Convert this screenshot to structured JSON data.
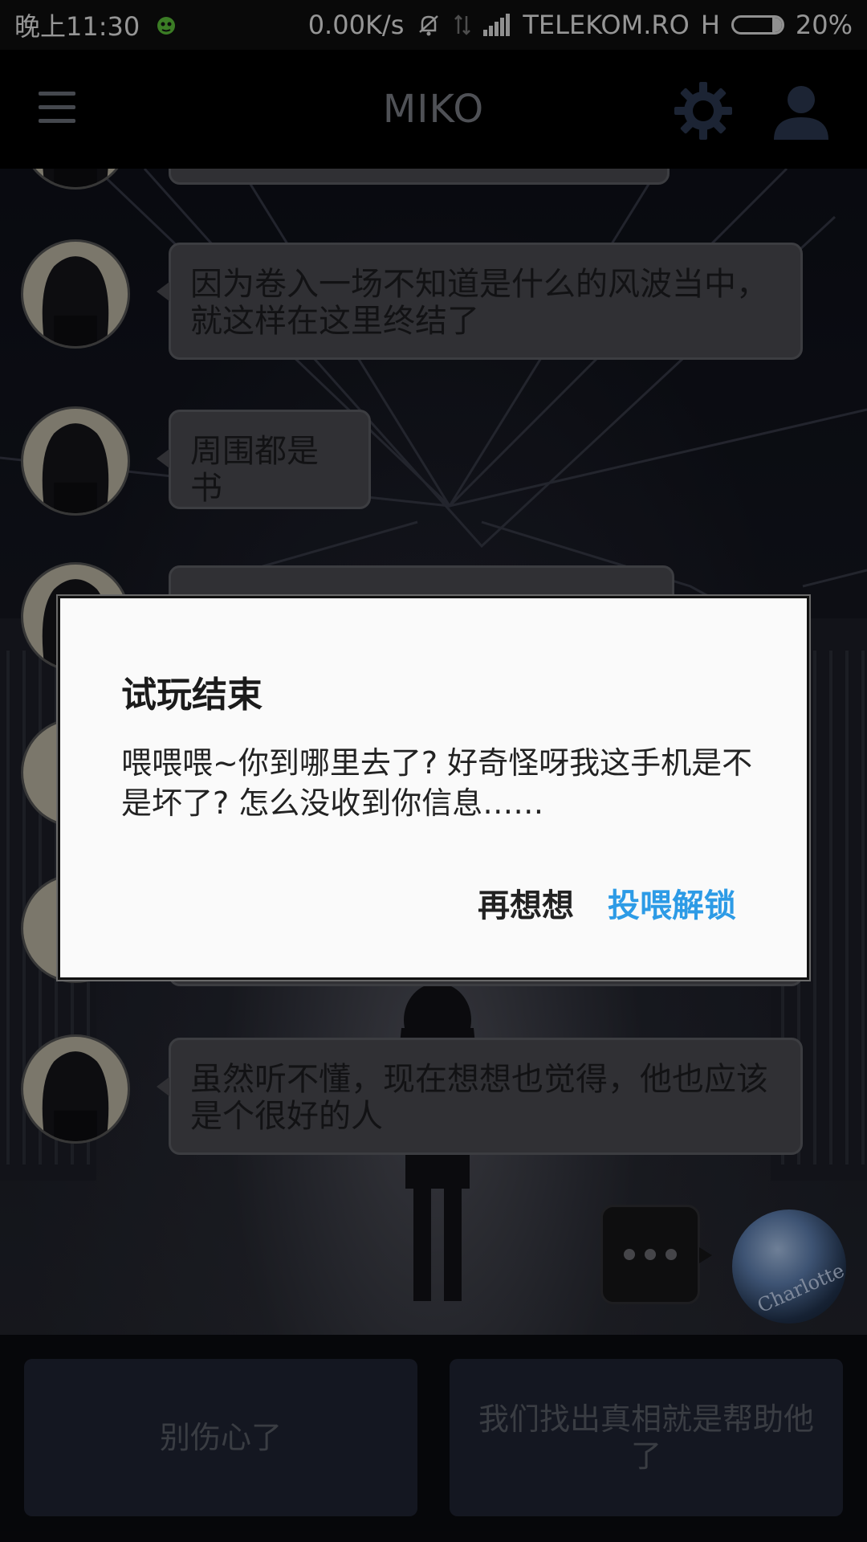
{
  "status_bar": {
    "time": "晚上11:30",
    "speed": "0.00K/s",
    "carrier": "TELEKOM.RO",
    "network": "H",
    "battery": "20%",
    "battery_level": 0.2
  },
  "app_bar": {
    "title": "MIKO"
  },
  "messages": [
    {
      "text": ""
    },
    {
      "text": "因为卷入一场不知道是什么的风波当中，就这样在这里终结了"
    },
    {
      "text": "周围都是书"
    },
    {
      "text": "虽然听不懂，现在想想也觉得，他也应该是个很好的人"
    }
  ],
  "character_avatar": {
    "label": "Charlotte"
  },
  "choices": [
    {
      "label": "别伤心了"
    },
    {
      "label": "我们找出真相就是帮助他了"
    }
  ],
  "dialog": {
    "title": "试玩结束",
    "message": "喂喂喂~你到哪里去了? 好奇怪呀我这手机是不是坏了? 怎么没收到你信息……",
    "cancel_label": "再想想",
    "confirm_label": "投喂解锁"
  },
  "colors": {
    "accent": "#2d9be6",
    "bubble": "#4a4b51",
    "choice_bg": "#1f2433"
  }
}
